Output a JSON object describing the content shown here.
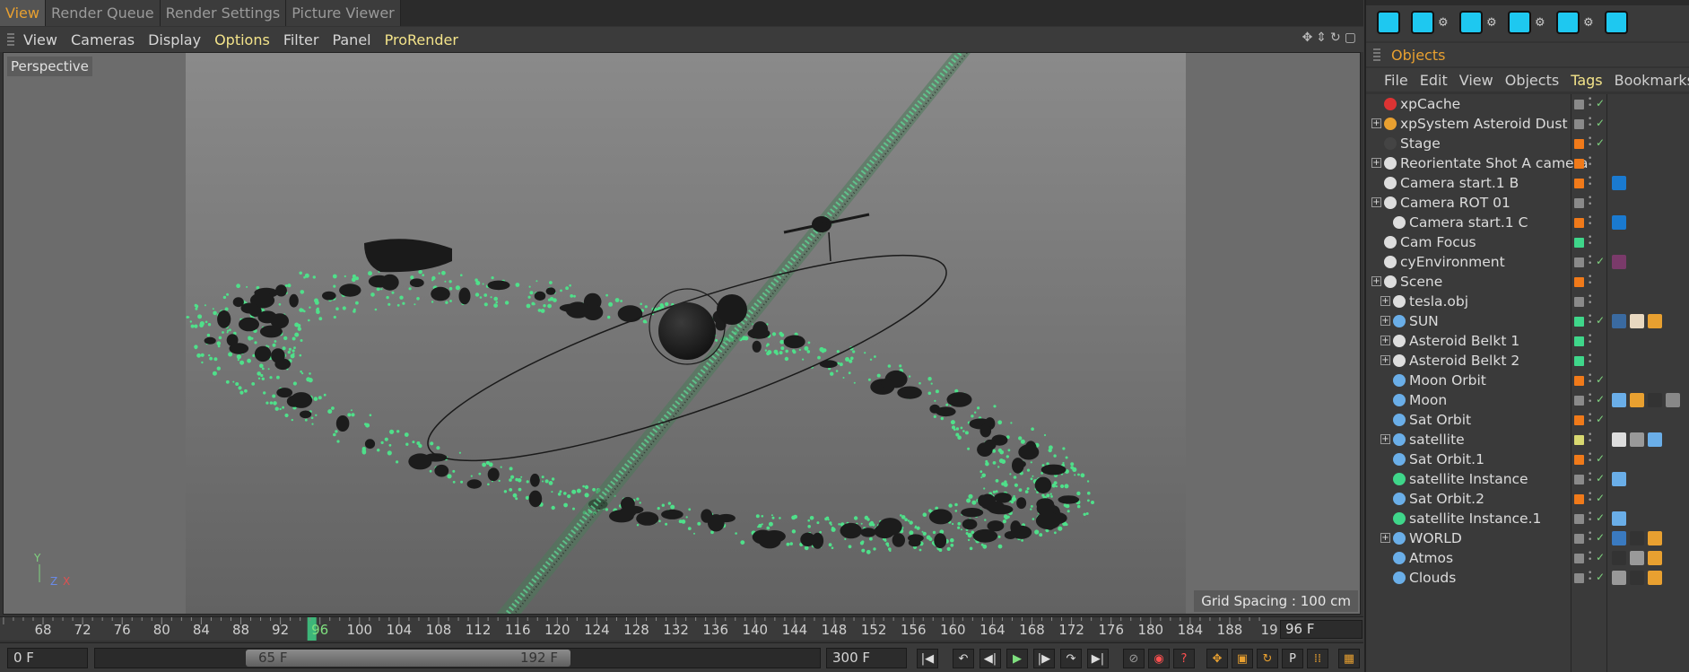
{
  "top_tabs": [
    "View",
    "Render Queue",
    "Render Settings",
    "Picture Viewer"
  ],
  "viewport_menu": [
    "View",
    "Cameras",
    "Display",
    "Options",
    "Filter",
    "Panel",
    "ProRender"
  ],
  "viewport": {
    "label": "Perspective",
    "grid_spacing": "Grid Spacing : 100 cm",
    "axis_labels": {
      "y": "Y",
      "z": "Z",
      "x": "X"
    }
  },
  "timeline": {
    "ticks": [
      "68",
      "72",
      "76",
      "80",
      "84",
      "88",
      "92",
      "96",
      "100",
      "104",
      "108",
      "112",
      "116",
      "120",
      "124",
      "128",
      "132",
      "136",
      "140",
      "144",
      "148",
      "152",
      "156",
      "160",
      "164",
      "168",
      "172",
      "176",
      "180",
      "184",
      "188",
      "19"
    ],
    "current_frame": "96 F",
    "start_field": "0 F",
    "range_start": "65 F",
    "range_end": "192 F",
    "end_field": "300 F"
  },
  "objects_panel": {
    "title": "Objects",
    "menu": [
      "File",
      "Edit",
      "View",
      "Objects",
      "Tags",
      "Bookmarks"
    ],
    "rows": [
      {
        "name": "xpCache",
        "indent": 0
      },
      {
        "name": "xpSystem Asteroid Dust",
        "indent": 0
      },
      {
        "name": "Stage",
        "indent": 0
      },
      {
        "name": "Reorientate Shot A camera",
        "indent": 0
      },
      {
        "name": "Camera start.1 B",
        "indent": 0
      },
      {
        "name": "Camera ROT 01",
        "indent": 0
      },
      {
        "name": "Camera start.1 C",
        "indent": 1
      },
      {
        "name": "Cam Focus",
        "indent": 0
      },
      {
        "name": "cyEnvironment",
        "indent": 0
      },
      {
        "name": "Scene",
        "indent": 0
      },
      {
        "name": "tesla.obj",
        "indent": 1
      },
      {
        "name": "SUN",
        "indent": 1
      },
      {
        "name": "Asteroid Belkt 1",
        "indent": 1
      },
      {
        "name": "Asteroid Belkt 2",
        "indent": 1
      },
      {
        "name": "Moon Orbit",
        "indent": 1
      },
      {
        "name": "Moon",
        "indent": 1
      },
      {
        "name": "Sat Orbit",
        "indent": 1
      },
      {
        "name": "satellite",
        "indent": 1
      },
      {
        "name": "Sat Orbit.1",
        "indent": 1
      },
      {
        "name": "satellite Instance",
        "indent": 1
      },
      {
        "name": "Sat Orbit.2",
        "indent": 1
      },
      {
        "name": "satellite Instance.1",
        "indent": 1
      },
      {
        "name": "WORLD",
        "indent": 1
      },
      {
        "name": "Atmos",
        "indent": 1
      },
      {
        "name": "Clouds",
        "indent": 1
      }
    ]
  },
  "colors": {
    "accent_orange": "#e8a030",
    "menu_highlight": "#f3e38a",
    "asteroid_green": "#4fe08a",
    "flag_orange": "#f07a1a",
    "flag_green": "#3fd68a",
    "flag_grey": "#8a8a8a",
    "flag_yellow": "#d8d870",
    "toolbar_cyan": "#1ec8f0"
  }
}
